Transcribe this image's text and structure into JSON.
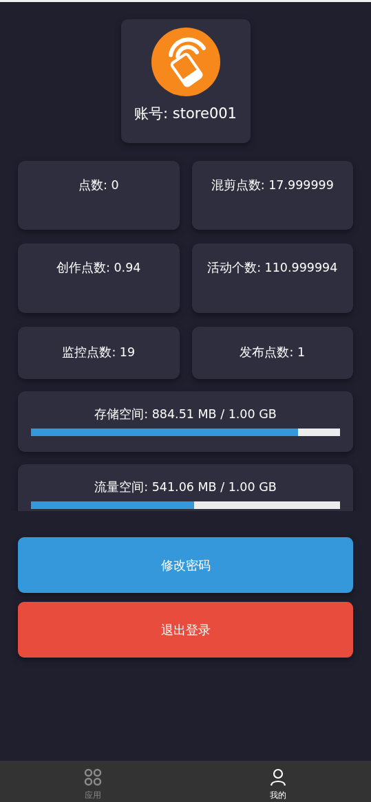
{
  "profile": {
    "account": "账号: store001"
  },
  "stats": [
    {
      "label": "点数: 0"
    },
    {
      "label": "混剪点数: 17.999999"
    },
    {
      "label": "创作点数: 0.94"
    },
    {
      "label": "活动个数: 110.999994"
    },
    {
      "label": "监控点数: 19"
    },
    {
      "label": "发布点数: 1"
    }
  ],
  "quotas": [
    {
      "label": "存储空间: 884.51 MB / 1.00 GB",
      "level": 0.864
    },
    {
      "label": "流量空间: 541.06 MB / 1.00 GB",
      "level": 0.528
    }
  ],
  "buttons": [
    {
      "label": "修改密码",
      "kind": "primary"
    },
    {
      "label": "退出登录",
      "kind": "danger"
    }
  ],
  "tabbar": [
    {
      "label": "应用",
      "kind": "apps",
      "selected": false
    },
    {
      "label": "我的",
      "kind": "profile",
      "selected": true
    }
  ]
}
